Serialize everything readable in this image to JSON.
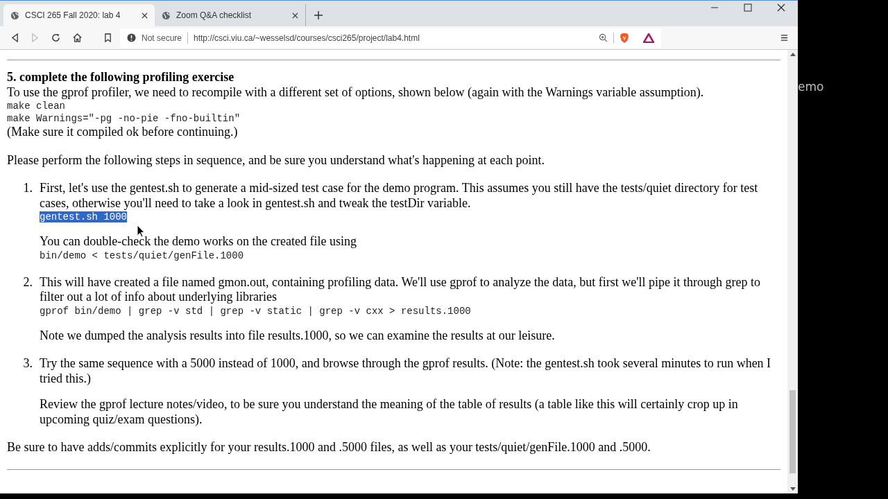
{
  "tabs": [
    {
      "title": "CSCI 265 Fall 2020: lab 4",
      "selected": true
    },
    {
      "title": "Zoom Q&A checklist",
      "selected": false
    }
  ],
  "address_bar": {
    "security": "Not secure",
    "url": "http://csci.viu.ca/~wesselsd/courses/csci265/project/lab4.html"
  },
  "page": {
    "heading": "5. complete the following profiling exercise",
    "intro": "To use the gprof profiler, we need to recompile with a different set of options, shown below (again with the Warnings variable assumption).",
    "code_lines": [
      "make clean",
      "make Warnings=\"-pg -no-pie -fno-builtin\""
    ],
    "note": "(Make sure it compiled ok before continuing.)",
    "lead": "Please perform the following steps in sequence, and be sure you understand what's happening at each point.",
    "steps": [
      {
        "number": "1.",
        "blocks": [
          {
            "kind": "text",
            "text": "First, let's use the gentest.sh to generate a mid-sized test case for the demo program. This assumes you still have the tests/quiet directory for test cases, otherwise you'll need to take a look in gentest.sh and tweak the testDir variable."
          },
          {
            "kind": "code",
            "text": "gentest.sh 1000",
            "selected": true
          },
          {
            "kind": "text",
            "text": "You can double-check the demo works on the created file using"
          },
          {
            "kind": "code",
            "text": "bin/demo < tests/quiet/genFile.1000",
            "selected": false
          }
        ]
      },
      {
        "number": "2.",
        "blocks": [
          {
            "kind": "text",
            "text": "This will have created a file named gmon.out, containing profiling data. We'll use gprof to analyze the data, but first we'll pipe it through grep to filter out a lot of info about underlying libraries"
          },
          {
            "kind": "code",
            "text": "gprof bin/demo | grep -v std | grep -v static | grep -v cxx > results.1000",
            "selected": false
          },
          {
            "kind": "text",
            "text": "Note we dumped the analysis results into file results.1000, so we can examine the results at our leisure."
          }
        ]
      },
      {
        "number": "3.",
        "blocks": [
          {
            "kind": "text",
            "text": "Try the same sequence with a 5000 instead of 1000, and browse through the gprof results. (Note: the gentest.sh took several minutes to run when I tried this.)"
          },
          {
            "kind": "text",
            "text": "Review the gprof lecture notes/video, to be sure you understand the meaning of the table of results (a table like this will certainly crop up in upcoming quiz/exam questions)."
          }
        ]
      }
    ],
    "closing": "Be sure to have adds/commits explicitly for your results.1000 and .5000 files, as well as your tests/quiet/genFile.1000 and .5000."
  },
  "desktop": {
    "text": "emo"
  }
}
